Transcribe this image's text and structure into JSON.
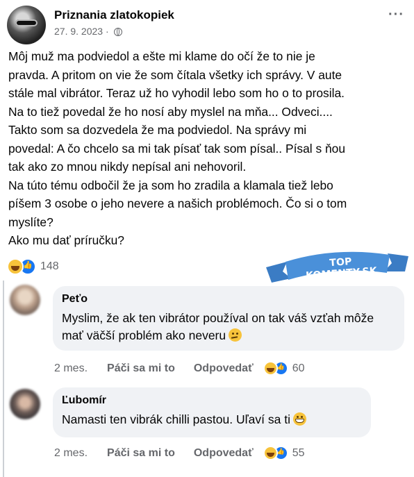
{
  "post": {
    "page_name": "Priznania zlatokopiek",
    "date": "27. 9. 2023",
    "dot": "·",
    "more": "···",
    "body_lines": [
      "Môj muž ma podviedol a ešte mi klame do očí že to nie je",
      "pravda. A pritom on vie že som čítala všetky ich správy. V aute",
      "stále mal vibrátor. Teraz už ho vyhodil lebo som ho o to prosila.",
      "Na to tiež povedal že ho nosí aby myslel na mňa... Odveci....",
      "Takto som sa dozvedela že ma podviedol. Na správy mi",
      "povedal: A čo chcelo sa mi tak písať tak som písal.. Písal s ňou",
      "tak ako zo mnou nikdy nepísal ani nehovoril.",
      "Na túto tému odbočil že ja som ho zradila a klamala tiež lebo",
      "píšem 3 osobe o jeho nevere a našich problémoch. Čo si o tom",
      "myslíte?",
      "Ako mu dať príručku?"
    ],
    "reaction_count": "148"
  },
  "banner": {
    "text": "TOP KOMENTY.SK"
  },
  "comments": [
    {
      "author": "Peťo",
      "text": "Myslim, že ak ten vibrátor používal on tak váš vzťah môže mať väčší problém ako neveru",
      "time": "2 mes.",
      "like": "Páči sa mi to",
      "reply": "Odpovedať",
      "reaction_count": "60"
    },
    {
      "author": "Ľubomír",
      "text": "Namasti ten vibrák chilli pastou. Uľaví sa ti",
      "time": "2 mes.",
      "like": "Páči sa mi to",
      "reply": "Odpovedať",
      "reaction_count": "55"
    }
  ],
  "colors": {
    "accent_blue": "#1877f2",
    "banner_blue": "#4a90d9",
    "muted": "#65676b",
    "bubble": "#f0f2f5"
  }
}
